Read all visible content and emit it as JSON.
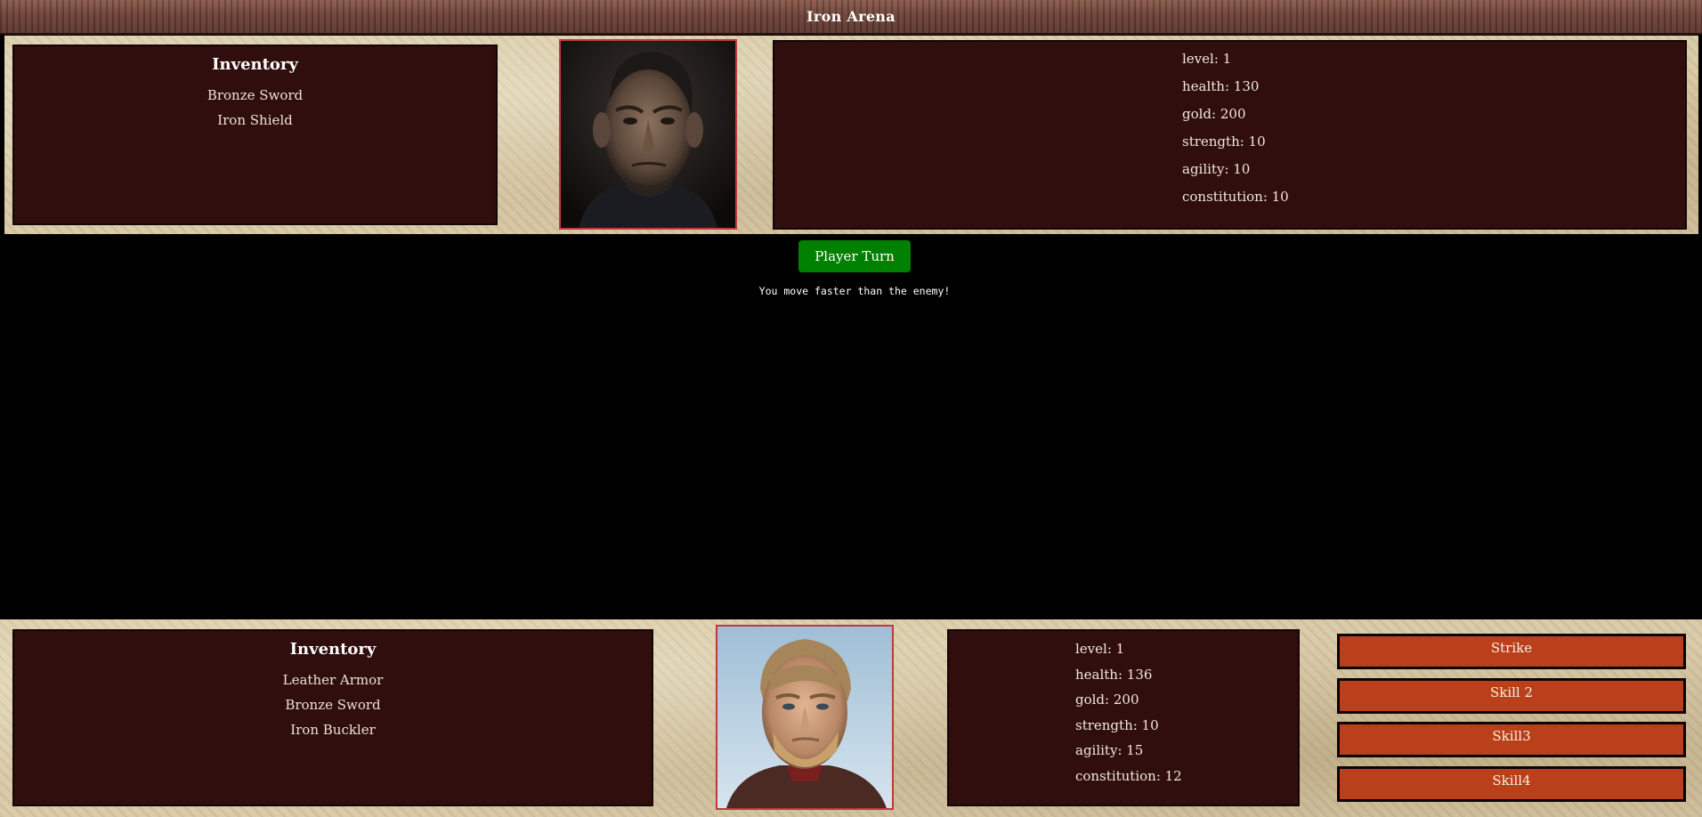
{
  "window": {
    "title": "Iron Arena"
  },
  "enemy": {
    "inventory": {
      "title": "Inventory",
      "items": [
        "Bronze Sword",
        "Iron Shield"
      ]
    },
    "stats": [
      "level: 1",
      "health: 130",
      "gold: 200",
      "strength: 10",
      "agility: 10",
      "constitution: 10"
    ]
  },
  "turn": {
    "label": "Player Turn"
  },
  "combat_log": {
    "message": "You move faster than the enemy!"
  },
  "player": {
    "inventory": {
      "title": "Inventory",
      "items": [
        "Leather Armor",
        "Bronze Sword",
        "Iron Buckler"
      ]
    },
    "stats": [
      "level: 1",
      "health: 136",
      "gold: 200",
      "strength: 10",
      "agility: 15",
      "constitution: 12"
    ],
    "skills": [
      "Strike",
      "Skill 2",
      "Skill3",
      "Skill4"
    ]
  },
  "colors": {
    "panel": "#300e0d",
    "parchment": "#d8c9a5",
    "turn_button": "#008000",
    "skill_button": "#b9401a",
    "portrait_border": "#c0393b"
  }
}
